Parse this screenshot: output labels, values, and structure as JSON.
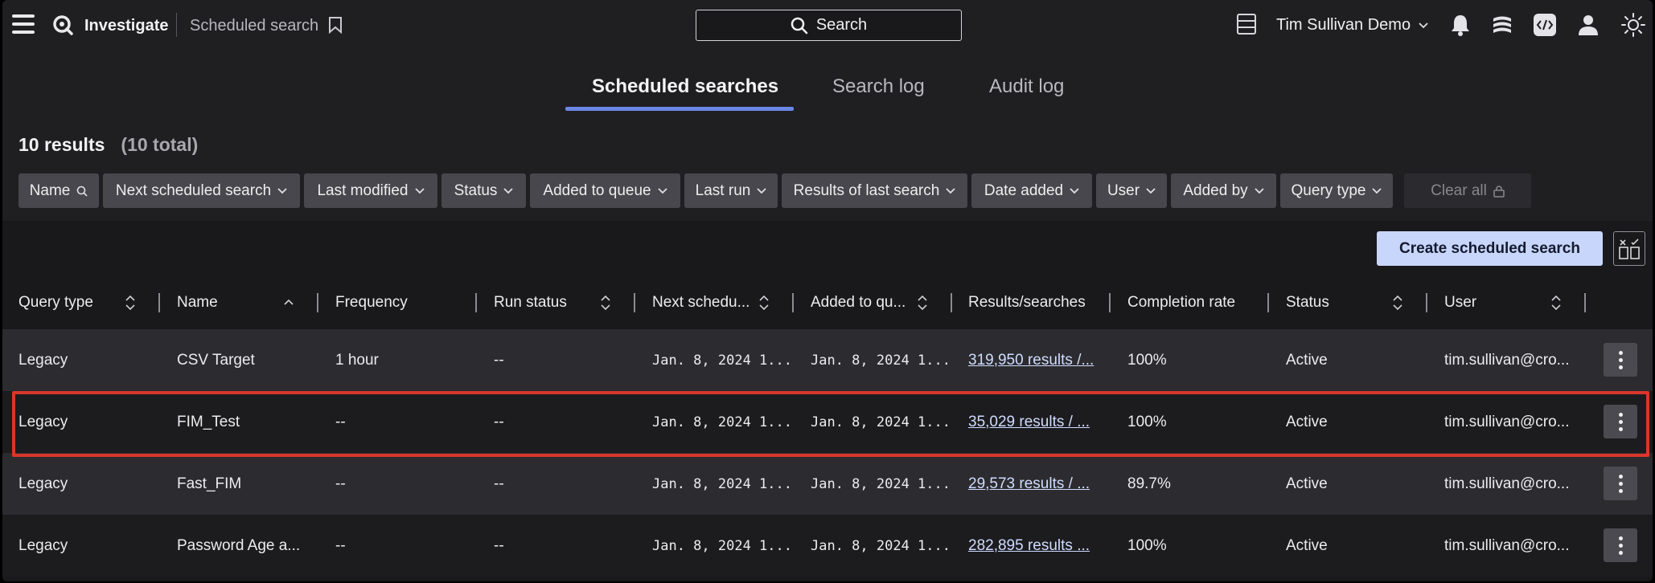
{
  "topbar": {
    "app_name": "Investigate",
    "page_crumb": "Scheduled search",
    "search_label": "Search",
    "account_name": "Tim Sullivan Demo",
    "icons": [
      "menu-icon",
      "logo-icon",
      "bookmark-icon",
      "search-icon",
      "server-icon",
      "bell-icon",
      "stack-icon",
      "code-icon",
      "user-icon",
      "sun-icon"
    ]
  },
  "tabs": [
    {
      "label": "Scheduled searches",
      "active": true
    },
    {
      "label": "Search log",
      "active": false
    },
    {
      "label": "Audit log",
      "active": false
    }
  ],
  "results": {
    "count": "10 results",
    "total": "(10 total)"
  },
  "filters": [
    "Name",
    "Next scheduled search",
    "Last modified",
    "Status",
    "Added to queue",
    "Last run",
    "Results of last search",
    "Date added",
    "User",
    "Added by",
    "Query type",
    "Clear all"
  ],
  "actions": {
    "create_label": "Create scheduled search"
  },
  "table": {
    "columns": [
      "Query type",
      "Name",
      "Frequency",
      "Run status",
      "Next schedu...",
      "Added to qu...",
      "Results/searches",
      "Completion rate",
      "Status",
      "User"
    ],
    "rows": [
      [
        "Legacy",
        "CSV Target",
        "1 hour",
        "--",
        "Jan. 8, 2024 1...",
        "Jan. 8, 2024 1...",
        "319,950 results /...",
        "100%",
        "Active",
        "tim.sullivan@cro..."
      ],
      [
        "Legacy",
        "FIM_Test",
        "--",
        "--",
        "Jan. 8, 2024 1...",
        "Jan. 8, 2024 1...",
        "35,029 results / ...",
        "100%",
        "Active",
        "tim.sullivan@cro..."
      ],
      [
        "Legacy",
        "Fast_FIM",
        "--",
        "--",
        "Jan. 8, 2024 1...",
        "Jan. 8, 2024 1...",
        "29,573 results / ...",
        "89.7%",
        "Active",
        "tim.sullivan@cro..."
      ],
      [
        "Legacy",
        "Password Age a...",
        "--",
        "--",
        "Jan. 8, 2024 1...",
        "Jan. 8, 2024 1...",
        "282,895 results ...",
        "100%",
        "Active",
        "tim.sullivan@cro..."
      ]
    ],
    "highlighted_row": "FIM_Test"
  },
  "colors": {
    "accent": "#6d87e6",
    "highlight": "#d9362b",
    "primary_button": "#c8d6fb"
  }
}
